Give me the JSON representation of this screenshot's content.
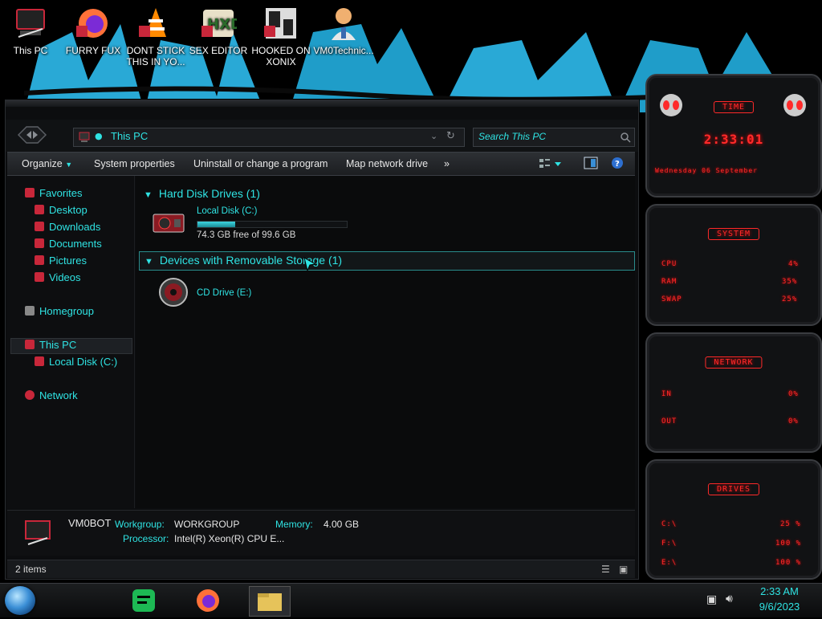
{
  "desktop": {
    "icons": [
      {
        "label_lines": [
          "This PC"
        ]
      },
      {
        "label_lines": [
          "FURRY FUX"
        ]
      },
      {
        "label_lines": [
          "DONT STICK",
          "THIS IN YO..."
        ]
      },
      {
        "label_lines": [
          "SEX EDITOR"
        ]
      },
      {
        "label_lines": [
          "HOOKED ON",
          "XONIX"
        ]
      },
      {
        "label_lines": [
          "VM0Technic..."
        ]
      }
    ]
  },
  "explorer": {
    "address": "This PC",
    "search_placeholder": "Search This PC",
    "toolbar": {
      "organize": "Organize",
      "system_properties": "System properties",
      "uninstall": "Uninstall or change a program",
      "map_drive": "Map network drive",
      "more": "»"
    },
    "nav": {
      "favorites": "Favorites",
      "desktop": "Desktop",
      "downloads": "Downloads",
      "documents": "Documents",
      "pictures": "Pictures",
      "videos": "Videos",
      "homegroup": "Homegroup",
      "this_pc": "This PC",
      "local_disk": "Local Disk (C:)",
      "network": "Network"
    },
    "groups": {
      "hard_disks": "Hard Disk Drives (1)",
      "removable": "Devices with Removable Storage (1)"
    },
    "drives": {
      "c_name": "Local Disk (C:)",
      "c_free": "74.3 GB free of 99.6 GB",
      "c_used_fraction": 0.254,
      "cd_name": "CD Drive (E:)"
    },
    "details": {
      "computer_name": "VM0BOT",
      "workgroup_label": "Workgroup:",
      "workgroup_value": "WORKGROUP",
      "memory_label": "Memory:",
      "memory_value": "4.00 GB",
      "processor_label": "Processor:",
      "processor_value": "Intel(R) Xeon(R) CPU E..."
    },
    "status": "2 items"
  },
  "gadgets": {
    "time": {
      "title": "TIME",
      "clock": "2:33:01",
      "date": "Wednesday 06 September"
    },
    "system": {
      "title": "SYSTEM",
      "cpu_label": "CPU",
      "cpu_value": "4%",
      "ram_label": "RAM",
      "ram_value": "35%",
      "swap_label": "SWAP",
      "swap_value": "25%"
    },
    "network": {
      "title": "NETWORK",
      "in_label": "IN",
      "in_value": "0%",
      "out_label": "OUT",
      "out_value": "0%"
    },
    "drives": {
      "title": "DRIVES",
      "rows": [
        {
          "label": "C:\\",
          "value": "25 %",
          "fraction": 0.25
        },
        {
          "label": "F:\\",
          "value": "100 %",
          "fraction": 1.0
        },
        {
          "label": "E:\\",
          "value": "100 %",
          "fraction": 1.0
        }
      ]
    }
  },
  "taskbar": {
    "time": "2:33 AM",
    "date": "9/6/2023"
  },
  "colors": {
    "accent": "#2fe3e3",
    "gadget_red": "#ff2a2a"
  }
}
